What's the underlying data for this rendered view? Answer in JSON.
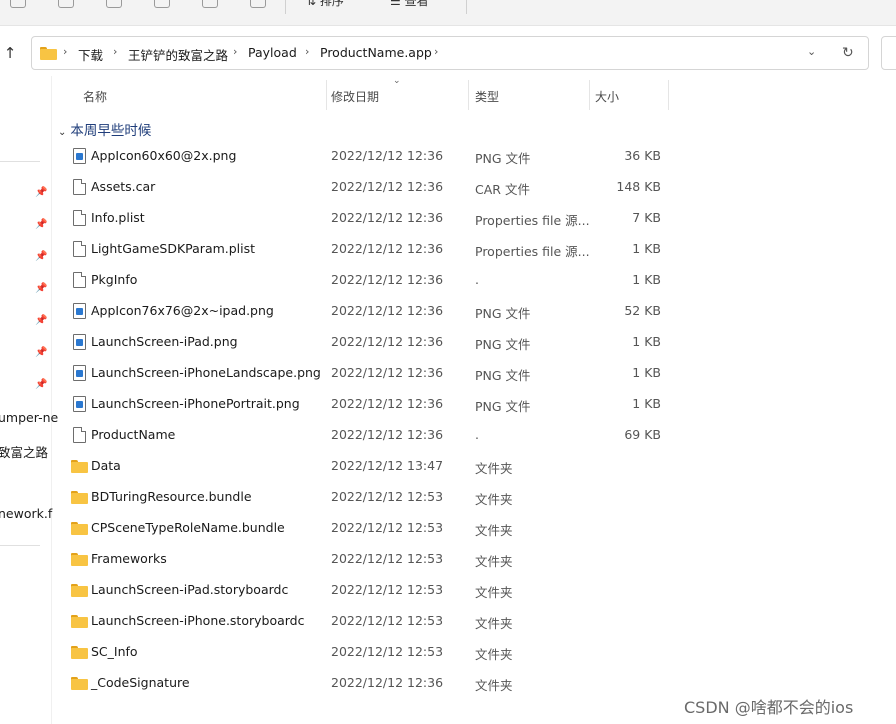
{
  "ribbon": {
    "sort_label": "排序",
    "view_label": "查看"
  },
  "address": {
    "crumbs": [
      "下载",
      "王铲铲的致富之路",
      "Payload",
      "ProductName.app"
    ]
  },
  "left_pane": {
    "items": [
      "umper-ne",
      "致富之路",
      "nework.f"
    ]
  },
  "columns": {
    "name": "名称",
    "date": "修改日期",
    "type": "类型",
    "size": "大小"
  },
  "group": {
    "label": "本周早些时候"
  },
  "files": [
    {
      "name": "AppIcon60x60@2x.png",
      "date": "2022/12/12 12:36",
      "type": "PNG 文件",
      "size": "36 KB",
      "icon": "image-file-icon"
    },
    {
      "name": "Assets.car",
      "date": "2022/12/12 12:36",
      "type": "CAR 文件",
      "size": "148 KB",
      "icon": "file-icon"
    },
    {
      "name": "Info.plist",
      "date": "2022/12/12 12:36",
      "type": "Properties file 源...",
      "size": "7 KB",
      "icon": "file-icon"
    },
    {
      "name": "LightGameSDKParam.plist",
      "date": "2022/12/12 12:36",
      "type": "Properties file 源...",
      "size": "1 KB",
      "icon": "file-icon"
    },
    {
      "name": "PkgInfo",
      "date": "2022/12/12 12:36",
      "type": ".",
      "size": "1 KB",
      "icon": "file-icon"
    },
    {
      "name": "AppIcon76x76@2x~ipad.png",
      "date": "2022/12/12 12:36",
      "type": "PNG 文件",
      "size": "52 KB",
      "icon": "image-file-icon"
    },
    {
      "name": "LaunchScreen-iPad.png",
      "date": "2022/12/12 12:36",
      "type": "PNG 文件",
      "size": "1 KB",
      "icon": "image-file-icon"
    },
    {
      "name": "LaunchScreen-iPhoneLandscape.png",
      "date": "2022/12/12 12:36",
      "type": "PNG 文件",
      "size": "1 KB",
      "icon": "image-file-icon"
    },
    {
      "name": "LaunchScreen-iPhonePortrait.png",
      "date": "2022/12/12 12:36",
      "type": "PNG 文件",
      "size": "1 KB",
      "icon": "image-file-icon"
    },
    {
      "name": "ProductName",
      "date": "2022/12/12 12:36",
      "type": ".",
      "size": "69 KB",
      "icon": "file-icon"
    },
    {
      "name": "Data",
      "date": "2022/12/12 13:47",
      "type": "文件夹",
      "size": "",
      "icon": "folder-icon"
    },
    {
      "name": "BDTuringResource.bundle",
      "date": "2022/12/12 12:53",
      "type": "文件夹",
      "size": "",
      "icon": "folder-icon"
    },
    {
      "name": "CPSceneTypeRoleName.bundle",
      "date": "2022/12/12 12:53",
      "type": "文件夹",
      "size": "",
      "icon": "folder-icon"
    },
    {
      "name": "Frameworks",
      "date": "2022/12/12 12:53",
      "type": "文件夹",
      "size": "",
      "icon": "folder-icon"
    },
    {
      "name": "LaunchScreen-iPad.storyboardc",
      "date": "2022/12/12 12:53",
      "type": "文件夹",
      "size": "",
      "icon": "folder-icon"
    },
    {
      "name": "LaunchScreen-iPhone.storyboardc",
      "date": "2022/12/12 12:53",
      "type": "文件夹",
      "size": "",
      "icon": "folder-icon"
    },
    {
      "name": "SC_Info",
      "date": "2022/12/12 12:53",
      "type": "文件夹",
      "size": "",
      "icon": "folder-icon"
    },
    {
      "name": "_CodeSignature",
      "date": "2022/12/12 12:36",
      "type": "文件夹",
      "size": "",
      "icon": "folder-icon"
    }
  ],
  "watermark": "CSDN @啥都不会的ios",
  "colors": {
    "folder": "#f8c443",
    "group_text": "#1f3d7a",
    "image_badge": "#2b78d0"
  }
}
